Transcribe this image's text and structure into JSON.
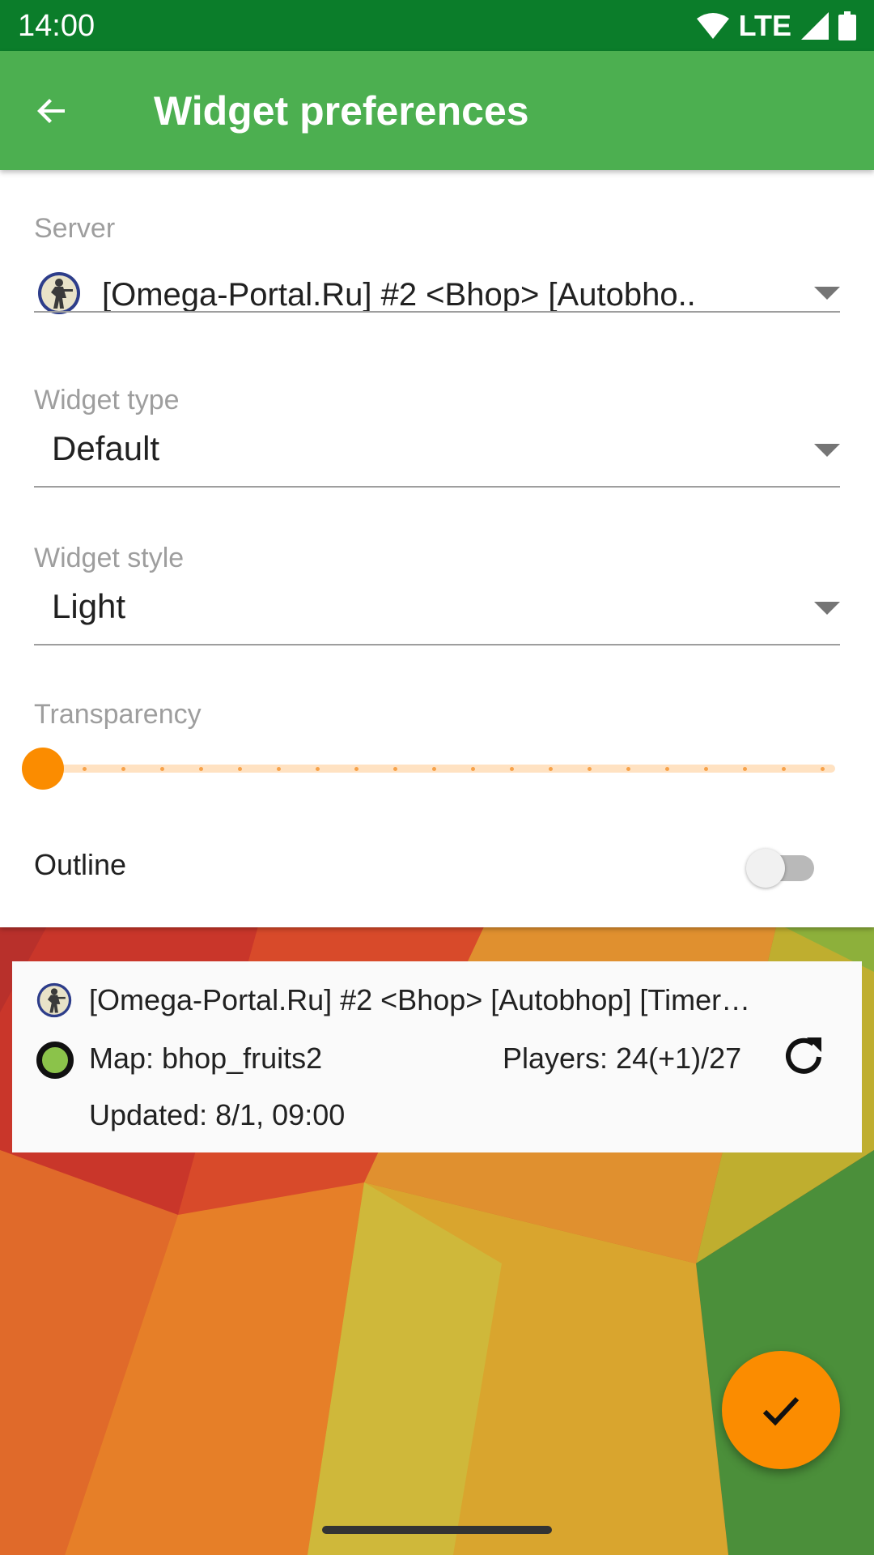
{
  "status_bar": {
    "time": "14:00",
    "network": "LTE",
    "icons": [
      "wifi-icon",
      "signal-icon",
      "battery-icon"
    ]
  },
  "app_bar": {
    "title": "Widget preferences",
    "back_icon": "arrow-back-icon"
  },
  "preferences": {
    "server": {
      "label": "Server",
      "value": "[Omega-Portal.Ru] #2 <Bhop> [Autobho.."
    },
    "widget_type": {
      "label": "Widget type",
      "value": "Default"
    },
    "widget_style": {
      "label": "Widget style",
      "value": "Light"
    },
    "transparency": {
      "label": "Transparency",
      "value_fraction": 0,
      "steps": 20
    },
    "outline": {
      "label": "Outline",
      "enabled": false
    }
  },
  "widget_preview": {
    "server_name": "[Omega-Portal.Ru] #2 <Bhop> [Autobhop] [Timer…",
    "map": "Map: bhop_fruits2",
    "players": "Players: 24(+1)/27",
    "updated": "Updated: 8/1, 09:00",
    "status": "online",
    "status_color": "#8bc34a"
  },
  "fab": {
    "icon": "check-icon",
    "color": "#fb8c00"
  },
  "colors": {
    "status_bar": "#0b7d2a",
    "app_bar": "#4caf50",
    "accent": "#fb8c00"
  }
}
